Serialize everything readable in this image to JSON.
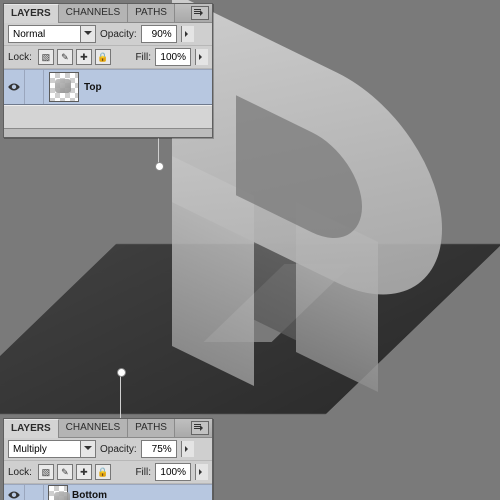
{
  "tabs": {
    "layers": "LAYERS",
    "channels": "CHANNELS",
    "paths": "PATHS"
  },
  "labels": {
    "opacity": "Opacity:",
    "fill": "Fill:",
    "lock": "Lock:"
  },
  "lockIcons": {
    "pixels": "▧",
    "position": "✎",
    "brush": "✚",
    "all": "🔒"
  },
  "panelTop": {
    "blendMode": "Normal",
    "opacity": "90%",
    "fill": "100%",
    "layerName": "Top"
  },
  "panelBottom": {
    "blendMode": "Multiply",
    "opacity": "75%",
    "fill": "100%",
    "layerName": "Bottom"
  }
}
